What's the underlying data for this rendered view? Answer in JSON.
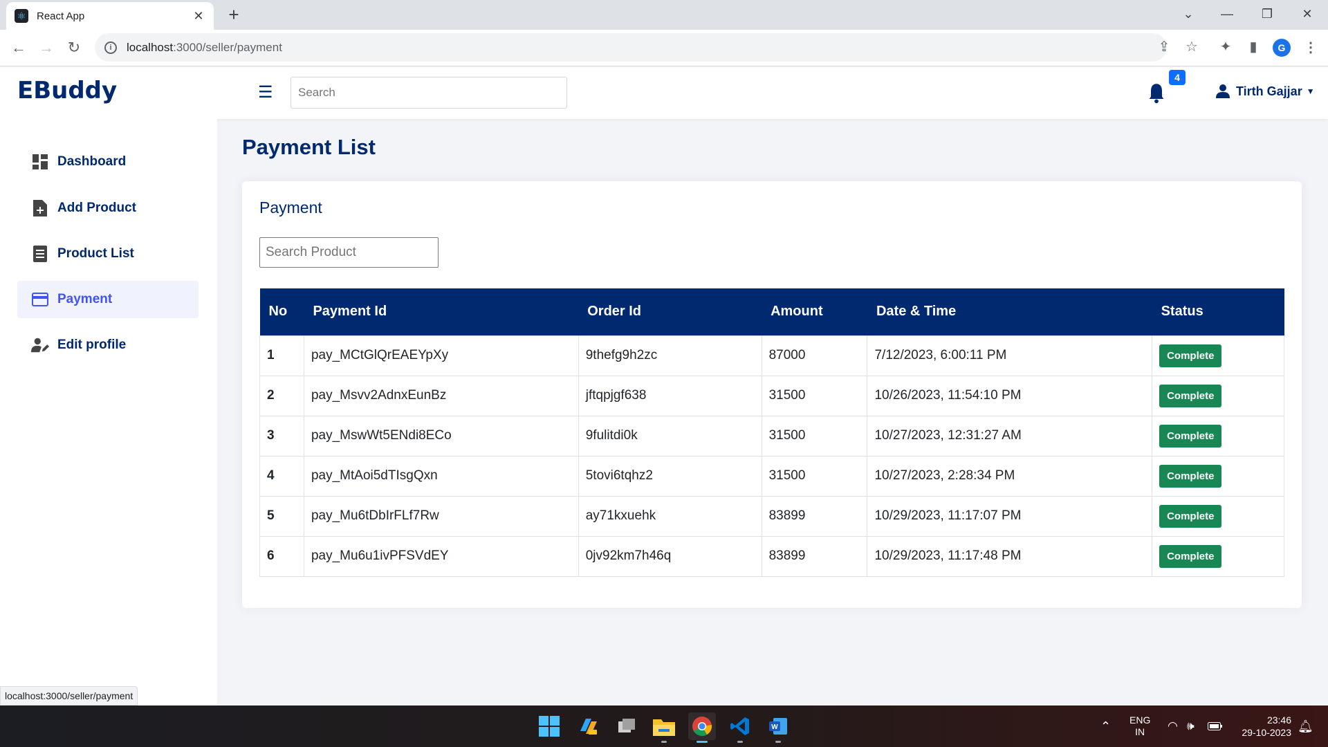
{
  "browser": {
    "tab_title": "React App",
    "url_host": "localhost",
    "url_rest": ":3000/seller/payment",
    "profile_initial": "G"
  },
  "header": {
    "logo": "EBuddy",
    "search_placeholder": "Search",
    "notification_count": "4",
    "user_name": "Tirth Gajjar"
  },
  "sidebar": {
    "items": [
      {
        "label": "Dashboard",
        "icon": "dashboard-icon"
      },
      {
        "label": "Add Product",
        "icon": "file-plus-icon"
      },
      {
        "label": "Product List",
        "icon": "list-icon"
      },
      {
        "label": "Payment",
        "icon": "credit-card-icon",
        "active": true
      },
      {
        "label": "Edit profile",
        "icon": "user-edit-icon"
      }
    ]
  },
  "main": {
    "page_title": "Payment List",
    "card_title": "Payment",
    "search_placeholder": "Search Product",
    "table": {
      "headers": [
        "No",
        "Payment Id",
        "Order Id",
        "Amount",
        "Date & Time",
        "Status"
      ],
      "rows": [
        [
          "1",
          "pay_MCtGlQrEAEYpXy",
          "9thefg9h2zc",
          "87000",
          "7/12/2023, 6:00:11 PM",
          "Complete"
        ],
        [
          "2",
          "pay_Msvv2AdnxEunBz",
          "jftqpjgf638",
          "31500",
          "10/26/2023, 11:54:10 PM",
          "Complete"
        ],
        [
          "3",
          "pay_MswWt5ENdi8ECo",
          "9fulitdi0k",
          "31500",
          "10/27/2023, 12:31:27 AM",
          "Complete"
        ],
        [
          "4",
          "pay_MtAoi5dTIsgQxn",
          "5tovi6tqhz2",
          "31500",
          "10/27/2023, 2:28:34 PM",
          "Complete"
        ],
        [
          "5",
          "pay_Mu6tDbIrFLf7Rw",
          "ay71kxuehk",
          "83899",
          "10/29/2023, 11:17:07 PM",
          "Complete"
        ],
        [
          "6",
          "pay_Mu6u1ivPFSVdEY",
          "0jv92km7h46q",
          "83899",
          "10/29/2023, 11:17:48 PM",
          "Complete"
        ]
      ]
    }
  },
  "status_bar_url": "localhost:3000/seller/payment",
  "taskbar": {
    "lang_top": "ENG",
    "lang_bottom": "IN",
    "time": "23:46",
    "date": "29-10-2023"
  },
  "colors": {
    "brand": "#012970",
    "accent": "#4154f1",
    "success": "#198754",
    "badge": "#0d6efd"
  }
}
